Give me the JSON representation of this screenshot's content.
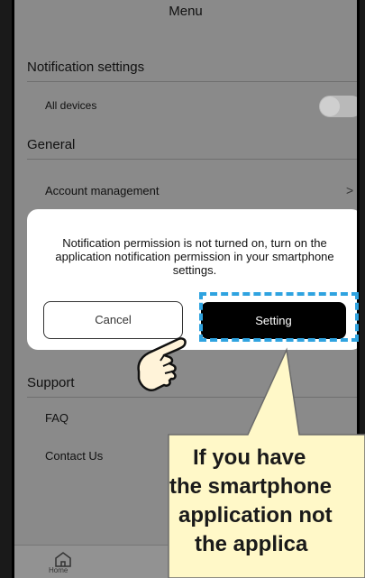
{
  "header": {
    "title": "Menu"
  },
  "sections": {
    "notification": {
      "title": "Notification settings",
      "all_devices_label": "All devices"
    },
    "general": {
      "title": "General",
      "account_label": "Account management",
      "account_chevron": ">"
    },
    "support": {
      "title": "Support",
      "faq_label": "FAQ",
      "contact_label": "Contact Us"
    }
  },
  "dialog": {
    "message": "Notification permission is not turned on, turn on the application notification permission in your smartphone settings.",
    "cancel_label": "Cancel",
    "setting_label": "Setting"
  },
  "bottom_nav": {
    "home_label": "Home"
  },
  "callout": {
    "lines": [
      "If you have",
      "the smartphone",
      "application not",
      "the applica"
    ]
  },
  "colors": {
    "highlight": "#2fa3e0",
    "callout_fill": "#fff8c8",
    "dialog_bg": "#ffffff",
    "overlay": "#8a8a8a"
  }
}
